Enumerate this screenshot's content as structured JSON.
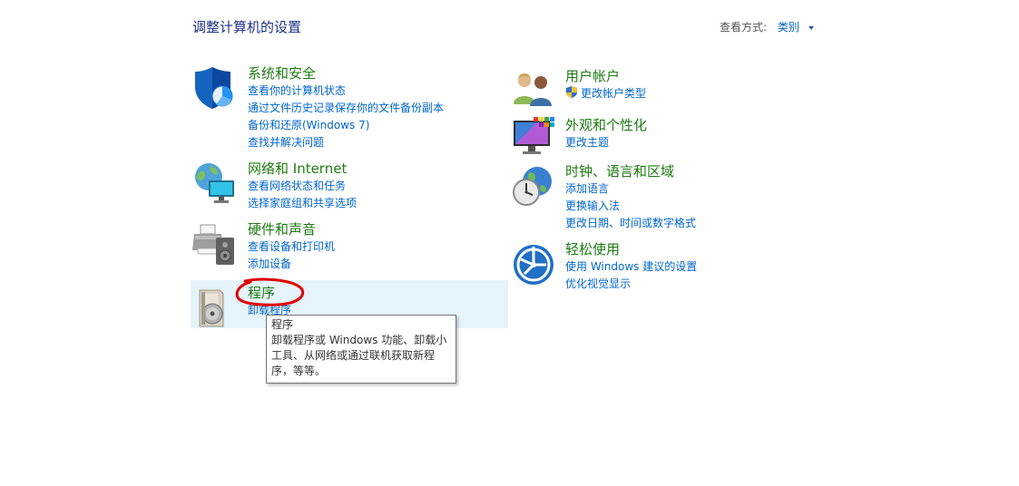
{
  "page": {
    "title": "调整计算机的设置",
    "view_by_label": "查看方式:",
    "view_by_value": "类别"
  },
  "left_categories": [
    {
      "title": "系统和安全",
      "icon": "shield-icon",
      "links": [
        "查看你的计算机状态",
        "通过文件历史记录保存你的文件备份副本",
        "备份和还原(Windows 7)",
        "查找并解决问题"
      ]
    },
    {
      "title": "网络和 Internet",
      "icon": "network-globe-icon",
      "links": [
        "查看网络状态和任务",
        "选择家庭组和共享选项"
      ]
    },
    {
      "title": "硬件和声音",
      "icon": "printer-speaker-icon",
      "links": [
        "查看设备和打印机",
        "添加设备"
      ]
    },
    {
      "title": "程序",
      "icon": "programs-disc-icon",
      "links": [
        "卸载程序"
      ]
    }
  ],
  "right_categories": [
    {
      "title": "用户帐户",
      "icon": "users-icon",
      "links": [
        "更改帐户类型"
      ]
    },
    {
      "title": "外观和个性化",
      "icon": "monitor-palette-icon",
      "links": [
        "更改主题"
      ]
    },
    {
      "title": "时钟、语言和区域",
      "icon": "clock-globe-icon",
      "links": [
        "添加语言",
        "更换输入法",
        "更改日期、时间或数字格式"
      ]
    },
    {
      "title": "轻松使用",
      "icon": "ease-of-access-icon",
      "links": [
        "使用 Windows 建议的设置",
        "优化视觉显示"
      ]
    }
  ],
  "tooltip": {
    "title": "程序",
    "line1": "卸载程序或 Windows 功能、卸载小",
    "line2": "工具、从网络或通过联机获取新程",
    "line3": "序，等等。"
  },
  "colors": {
    "category_title": "#1e7b12",
    "link": "#0066cc",
    "header": "#1e3287",
    "hover_bg": "#e5f3fb",
    "annotation_red": "#e00000"
  }
}
